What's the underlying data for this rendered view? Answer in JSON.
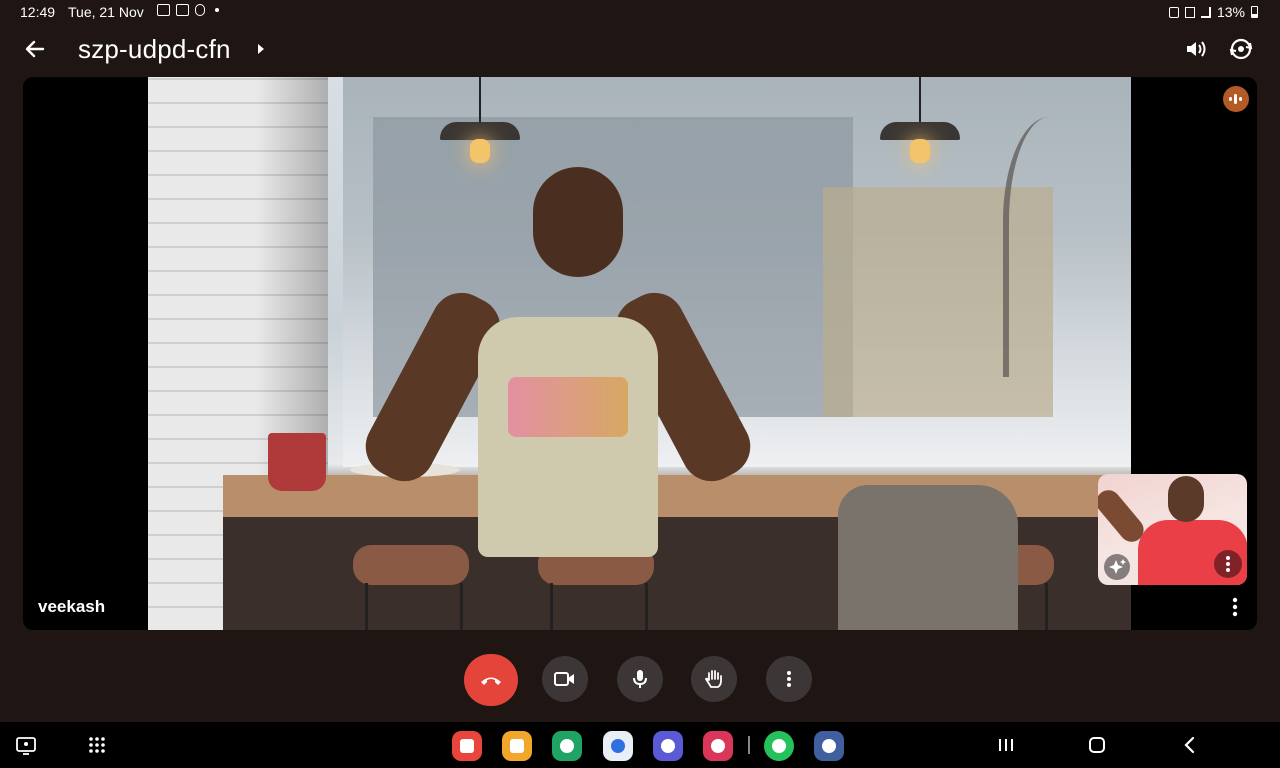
{
  "status_bar": {
    "time": "12:49",
    "date": "Tue, 21 Nov",
    "battery": "13%"
  },
  "header": {
    "meeting_code": "szp-udpd-cfn",
    "icons": [
      "back-arrow-icon",
      "speaker-volume-icon",
      "switch-camera-icon"
    ]
  },
  "stage": {
    "participant_name": "veekash",
    "speaking_indicator": "audio-activity-icon"
  },
  "self_view": {
    "effects_icon": "sparkle-effects-icon",
    "more_icon": "more-vertical-icon"
  },
  "controls": [
    {
      "name": "end-call-button",
      "icon": "phone-hangup-icon"
    },
    {
      "name": "camera-button",
      "icon": "video-camera-icon"
    },
    {
      "name": "microphone-button",
      "icon": "microphone-icon"
    },
    {
      "name": "raise-hand-button",
      "icon": "hand-icon"
    },
    {
      "name": "more-options-button",
      "icon": "more-vertical-icon"
    }
  ],
  "taskbar": {
    "apps": [
      "Samsung Notes",
      "My Files",
      "Phone",
      "Messages",
      "Internet",
      "Camera",
      "WhatsApp",
      "Settings"
    ]
  },
  "colors": {
    "background": "#1f1614",
    "end_call": "#e5443a",
    "control": "#3c3636",
    "speaking": "#b45a26"
  }
}
